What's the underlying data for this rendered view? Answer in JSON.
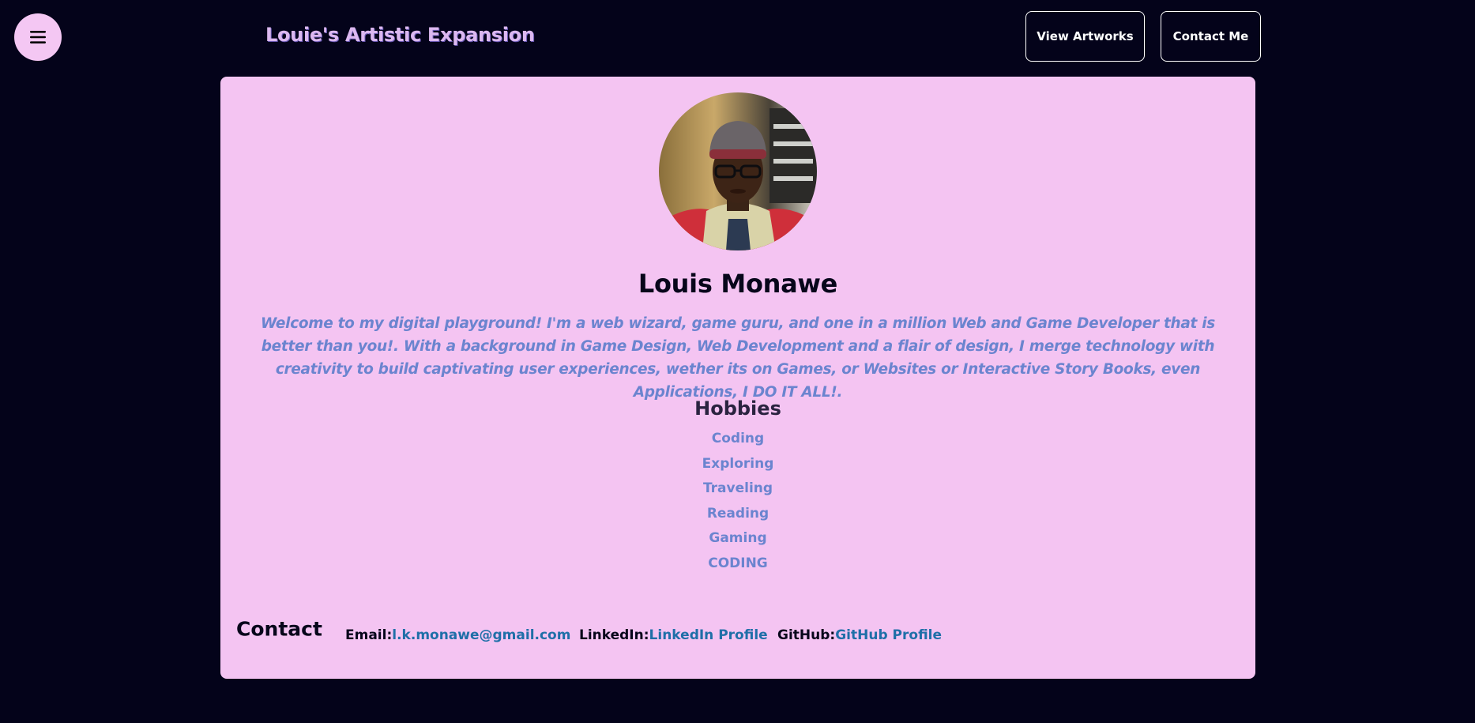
{
  "header": {
    "menu_icon": "hamburger-menu-icon",
    "title": "Louie's Artistic Expansion",
    "view_artworks_label": "View Artworks",
    "contact_me_label": "Contact Me"
  },
  "profile": {
    "name": "Louis Monawe",
    "bio": "Welcome to my digital playground! I'm a web wizard, game guru, and one in a million Web and Game Developer that is better than you!. With a background in Game Design, Web Development and a flair of design, I merge technology with creativity to build captivating user experiences, wether its on Games, or Websites or Interactive Story Books, even Applications, I DO IT ALL!."
  },
  "hobbies": {
    "title": "Hobbies",
    "items": [
      "Coding",
      "Exploring",
      "Traveling",
      "Reading",
      "Gaming",
      "CODING"
    ]
  },
  "contact": {
    "heading": "Contact",
    "email_label": "Email:",
    "email_value": "l.k.monawe@gmail.com",
    "linkedin_label": "LinkedIn:",
    "linkedin_value": "LinkedIn Profile",
    "github_label": "GitHub:",
    "github_value": "GitHub Profile"
  },
  "colors": {
    "page_background": "#04031a",
    "card_background": "#f4c4f2",
    "accent_text": "#6b84cf",
    "link": "#1f6fa8",
    "title": "#dcb8f0"
  }
}
